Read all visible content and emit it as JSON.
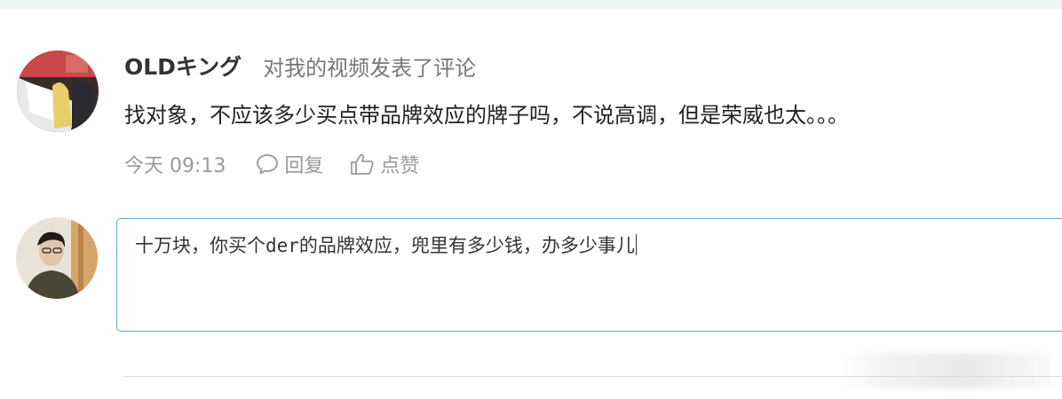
{
  "comment": {
    "username": "OLDキング",
    "action": "对我的视频发表了评论",
    "content": "找对象，不应该多少买点带品牌效应的牌子吗，不说高调，但是荣威也太。。。",
    "timestamp": "今天 09:13",
    "reply_label": "回复",
    "like_label": "点赞"
  },
  "reply_box": {
    "value": "十万块，你买个der的品牌效应，兜里有多少钱，办多少事儿"
  },
  "colors": {
    "accent_border": "#5aa7e0",
    "meta_text": "#999999",
    "top_bar": "#eef4f4"
  },
  "icons": {
    "reply": "speech-bubble-icon",
    "like": "thumbs-up-icon"
  }
}
